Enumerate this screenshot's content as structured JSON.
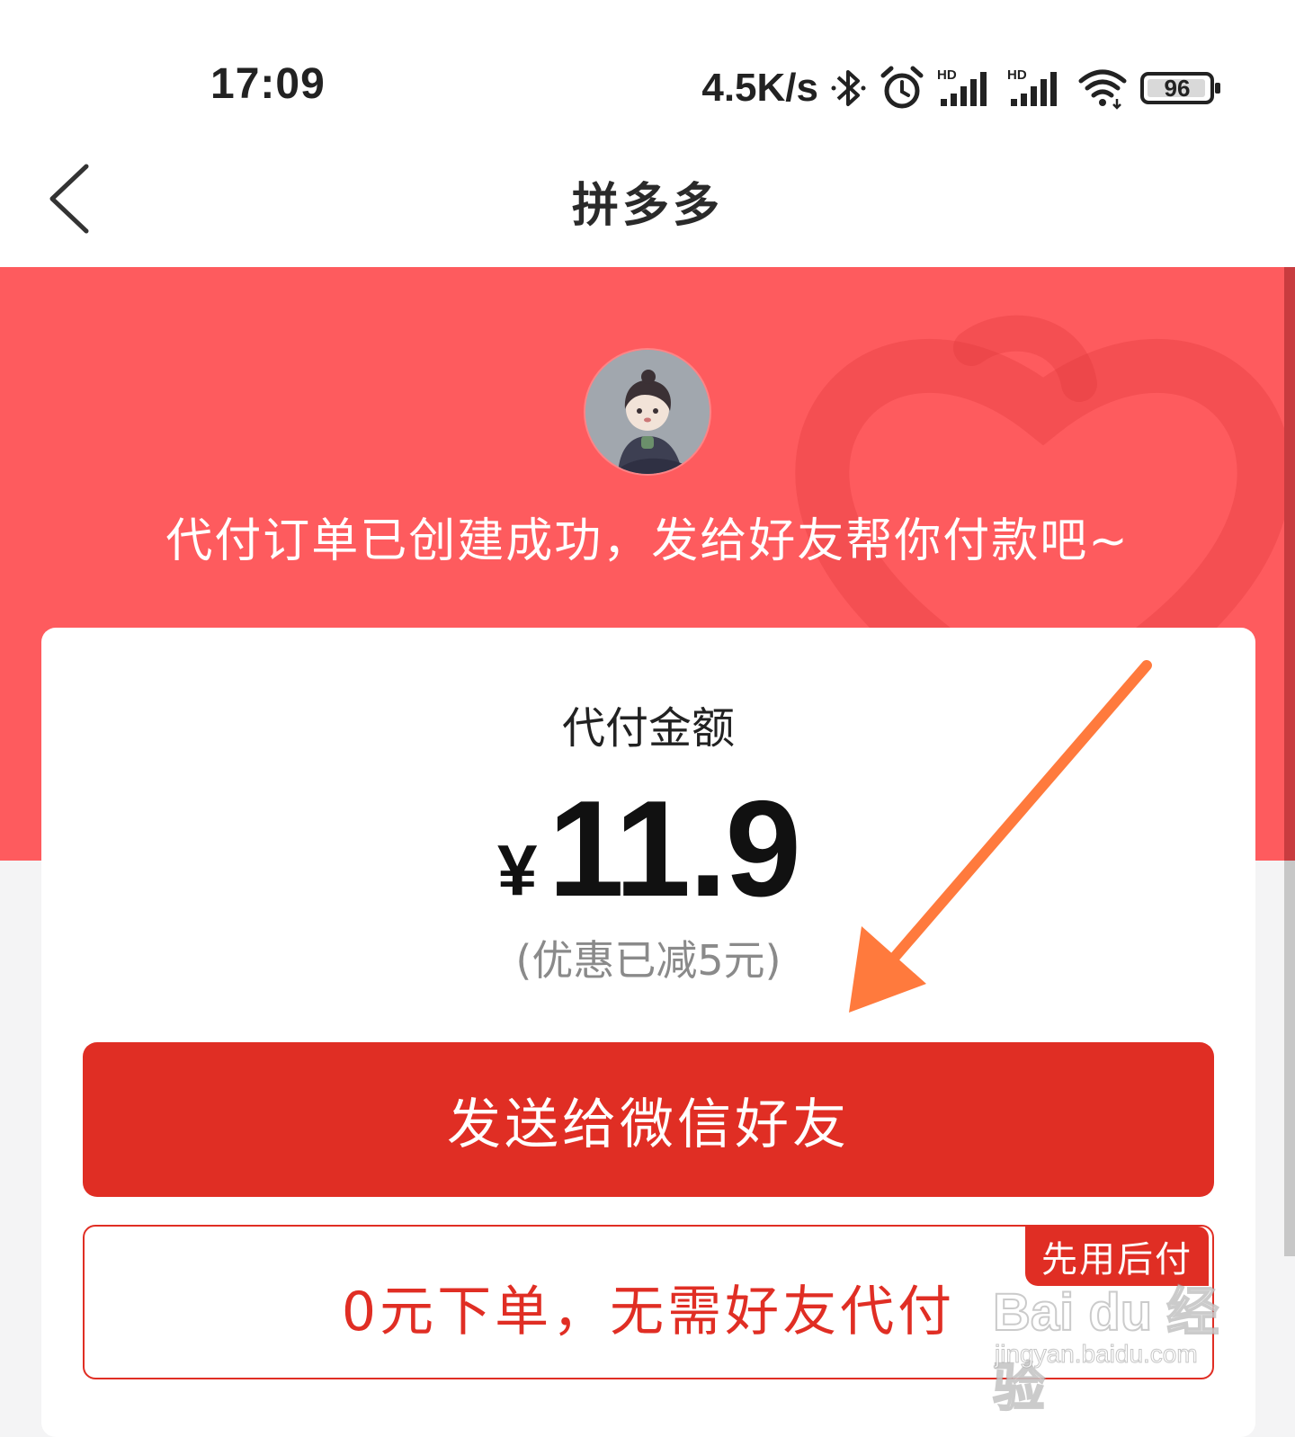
{
  "status_bar": {
    "time": "17:09",
    "net_speed": "4.5K/s",
    "icons": [
      "bluetooth-icon",
      "alarm-icon",
      "hd-signal-icon",
      "hd-signal-icon",
      "wifi-icon",
      "battery-icon"
    ],
    "battery_level": "96"
  },
  "nav": {
    "back_icon": "chevron-left-icon",
    "title": "拼多多"
  },
  "hero": {
    "message": "代付订单已创建成功，发给好友帮你付款吧~",
    "background_color": "#fe5b5e"
  },
  "payment": {
    "label": "代付金额",
    "currency": "¥",
    "amount": "11.9",
    "discount": "(优惠已减5元)"
  },
  "actions": {
    "primary_label": "发送给微信好友",
    "secondary_label": "0元下单，无需好友代付",
    "secondary_badge": "先用后付",
    "accent_color": "#e02e24"
  },
  "watermark": {
    "brand": "Bai du 经验",
    "url": "jingyan.baidu.com"
  }
}
